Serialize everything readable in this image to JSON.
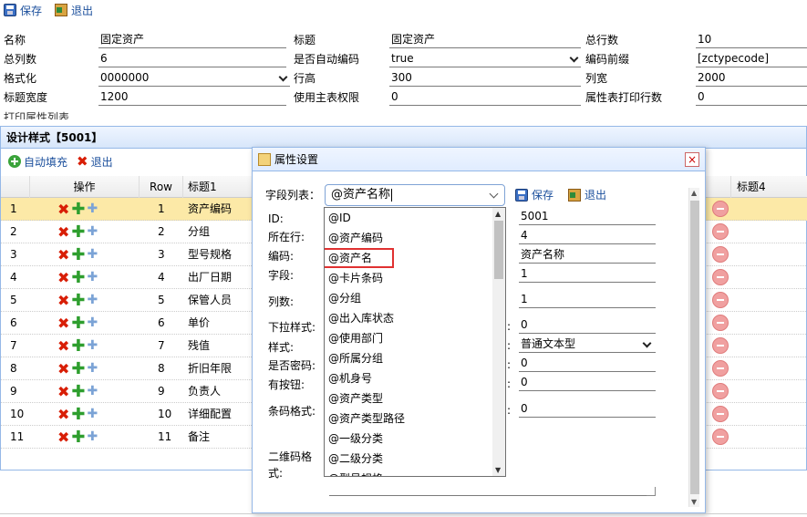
{
  "toolbar": {
    "save_label": "保存",
    "exit_label": "退出"
  },
  "form": {
    "rows": [
      [
        {
          "label": "名称",
          "value": "固定资产"
        },
        {
          "label": "标题",
          "value": "固定资产"
        },
        {
          "label": "总行数",
          "value": "10"
        }
      ],
      [
        {
          "label": "总列数",
          "value": "6"
        },
        {
          "label": "是否自动编码",
          "value": "true"
        },
        {
          "label": "编码前缀",
          "value": "[zctypecode]"
        }
      ],
      [
        {
          "label": "格式化",
          "value": "0000000"
        },
        {
          "label": "行高",
          "value": "300"
        },
        {
          "label": "列宽",
          "value": "2000"
        }
      ],
      [
        {
          "label": "标题宽度",
          "value": "1200"
        },
        {
          "label": "使用主表权限",
          "value": "0"
        },
        {
          "label": "属性表打印行数",
          "value": "0"
        }
      ]
    ],
    "print_attr_label": "打印属性列表"
  },
  "panel": {
    "title": "设计样式【5001】",
    "autofill_label": "自动填充",
    "exit_label": "退出",
    "columns": {
      "ops": "操作",
      "row": "Row",
      "title1": "标题1",
      "title4": "标题4"
    },
    "rows": [
      {
        "n": "1",
        "row": "1",
        "title": "资产编码"
      },
      {
        "n": "2",
        "row": "2",
        "title": "分组"
      },
      {
        "n": "3",
        "row": "3",
        "title": "型号规格"
      },
      {
        "n": "4",
        "row": "4",
        "title": "出厂日期"
      },
      {
        "n": "5",
        "row": "5",
        "title": "保管人员"
      },
      {
        "n": "6",
        "row": "6",
        "title": "单价"
      },
      {
        "n": "7",
        "row": "7",
        "title": "残值"
      },
      {
        "n": "8",
        "row": "8",
        "title": "折旧年限"
      },
      {
        "n": "9",
        "row": "9",
        "title": "负责人"
      },
      {
        "n": "10",
        "row": "10",
        "title": "详细配置"
      },
      {
        "n": "11",
        "row": "11",
        "title": "备注"
      }
    ]
  },
  "dialog": {
    "title": "属性设置",
    "field_list_label": "字段列表：",
    "field_list_value": "@资产名称",
    "save_label": "保存",
    "exit_label": "退出",
    "labels": {
      "id": "ID:",
      "row": "所在行:",
      "code": "编码:",
      "field": "字段:",
      "cols": "列数:",
      "dropdown_style": "下拉样式:",
      "style": "样式:",
      "is_password": "是否密码:",
      "has_button": "有按钮:",
      "barcode_format": "条码格式:",
      "qrcode_format_1": "二维码格",
      "qrcode_format_2": "式:"
    },
    "values": {
      "id": "5001",
      "row": "4",
      "code": "资产名称",
      "field": "1",
      "cols": "1",
      "dropdown_style": "0",
      "style": "普通文本型",
      "is_password": "0",
      "has_button": "0",
      "barcode_format": "0"
    },
    "colon": ":",
    "options": [
      "@ID",
      "@资产编码",
      "@资产名",
      "@卡片条码",
      "@分组",
      "@出入库状态",
      "@使用部门",
      "@所属分组",
      "@机身号",
      "@资产类型",
      "@资产类型路径",
      "@一级分类",
      "@二级分类",
      "@型号规格"
    ]
  },
  "icons": {
    "close": "×",
    "up": "▲",
    "down": "▼",
    "delete": "✖",
    "add": "✚",
    "move": "✚"
  }
}
